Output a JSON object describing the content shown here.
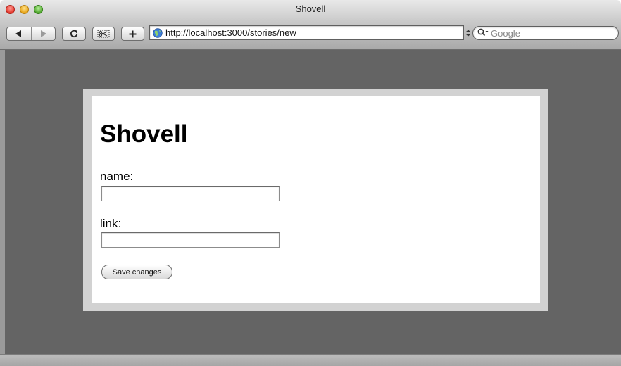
{
  "window": {
    "title": "Shovell"
  },
  "toolbar": {
    "url": "http://localhost:3000/stories/new",
    "search_placeholder": "Google",
    "icons": [
      "back-arrow-icon",
      "forward-arrow-icon",
      "reload-icon",
      "snip-icon",
      "plus-icon",
      "globe-icon",
      "search-icon"
    ]
  },
  "page": {
    "heading": "Shovell",
    "form": {
      "name_label": "name:",
      "name_value": "",
      "link_label": "link:",
      "link_value": "",
      "submit_label": "Save changes"
    }
  },
  "colors": {
    "content_background": "#646464",
    "card_border": "#d2d2d2",
    "card_background": "#ffffff"
  }
}
